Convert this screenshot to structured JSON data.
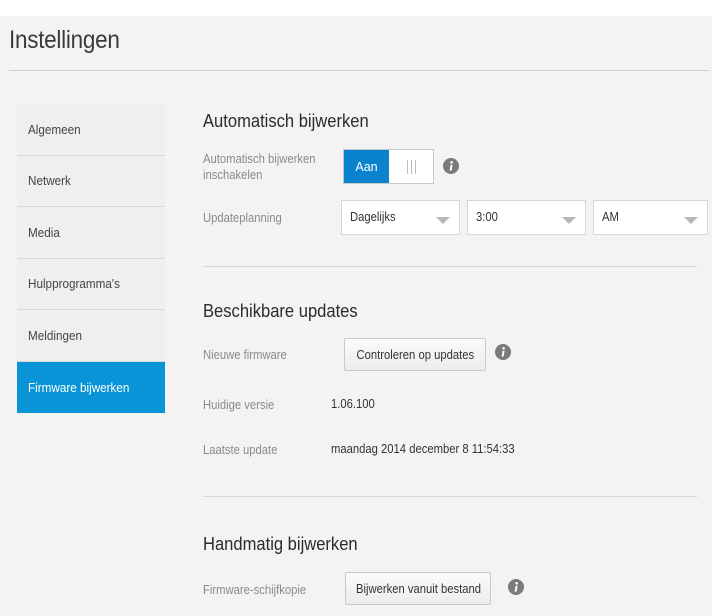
{
  "header": {
    "title": "Instellingen"
  },
  "sidebar": {
    "items": [
      {
        "label": "Algemeen"
      },
      {
        "label": "Netwerk"
      },
      {
        "label": "Media"
      },
      {
        "label": "Hulpprogramma's"
      },
      {
        "label": "Meldingen"
      },
      {
        "label": "Firmware bijwerken"
      }
    ]
  },
  "auto_update": {
    "title": "Automatisch bijwerken",
    "enable_label_line1": "Automatisch bijwerken",
    "enable_label_line2": "inschakelen",
    "toggle_state": "Aan",
    "schedule_label": "Updateplanning",
    "frequency": "Dagelijks",
    "time": "3:00",
    "ampm": "AM"
  },
  "available_updates": {
    "title": "Beschikbare updates",
    "new_firmware_label": "Nieuwe firmware",
    "check_button": "Controleren op updates",
    "current_version_label": "Huidige versie",
    "current_version": "1.06.100",
    "last_update_label": "Laatste update",
    "last_update": "maandag 2014 december 8 11:54:33"
  },
  "manual_update": {
    "title": "Handmatig bijwerken",
    "image_label": "Firmware-schijfkopie",
    "file_button": "Bijwerken vanuit bestand"
  },
  "colors": {
    "accent": "#0a94d8",
    "toggle_on": "#0a83cf",
    "background": "#f3f3f3",
    "info_icon": "#7a7a7a"
  },
  "icons": [
    "info-icon",
    "dropdown-arrow-icon"
  ]
}
